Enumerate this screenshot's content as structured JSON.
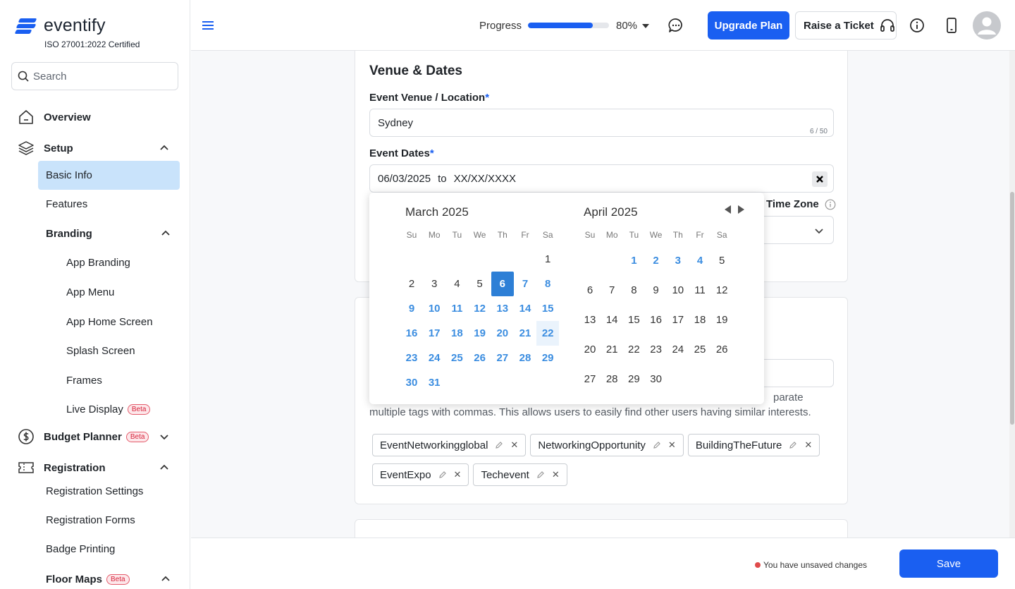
{
  "brand": {
    "name": "eventify",
    "certification": "ISO 27001:2022 Certified",
    "accent": "#1a5ff1"
  },
  "search": {
    "placeholder": "Search"
  },
  "sidebar": {
    "overview": "Overview",
    "setup": "Setup",
    "basic_info": "Basic Info",
    "features": "Features",
    "branding": "Branding",
    "app_branding": "App Branding",
    "app_menu": "App Menu",
    "app_home_screen": "App Home Screen",
    "splash_screen": "Splash Screen",
    "frames": "Frames",
    "live_display": "Live Display",
    "budget_planner": "Budget Planner",
    "registration": "Registration",
    "registration_settings": "Registration Settings",
    "registration_forms": "Registration Forms",
    "badge_printing": "Badge Printing",
    "floor_maps": "Floor Maps",
    "beta": "Beta"
  },
  "topbar": {
    "progress_label": "Progress",
    "progress_value": 80,
    "progress_text": "80%",
    "upgrade": "Upgrade Plan",
    "ticket": "Raise a Ticket"
  },
  "venue": {
    "title": "Venue & Dates",
    "location_label": "Event Venue / Location",
    "location_value": "Sydney",
    "location_counter": "6 / 50",
    "dates_label": "Event Dates",
    "start_date": "06/03/2025",
    "to": "to",
    "end_date": "XX/XX/XXXX",
    "timezone_label": "Time Zone"
  },
  "tags_section": {
    "help_text": "parate multiple tags with commas. This allows users to easily find other users having similar interests.",
    "tags": [
      "EventNetworkingglobal",
      "NetworkingOpportunity",
      "BuildingTheFuture",
      "EventExpo",
      "Techevent"
    ]
  },
  "calendar": {
    "weekdays": [
      "Su",
      "Mo",
      "Tu",
      "We",
      "Th",
      "Fr",
      "Sa"
    ],
    "left_month": "March 2025",
    "right_month": "April 2025",
    "selected_day": 6,
    "hover_day": 22
  },
  "footer": {
    "unsaved": "You have unsaved changes",
    "save": "Save"
  }
}
